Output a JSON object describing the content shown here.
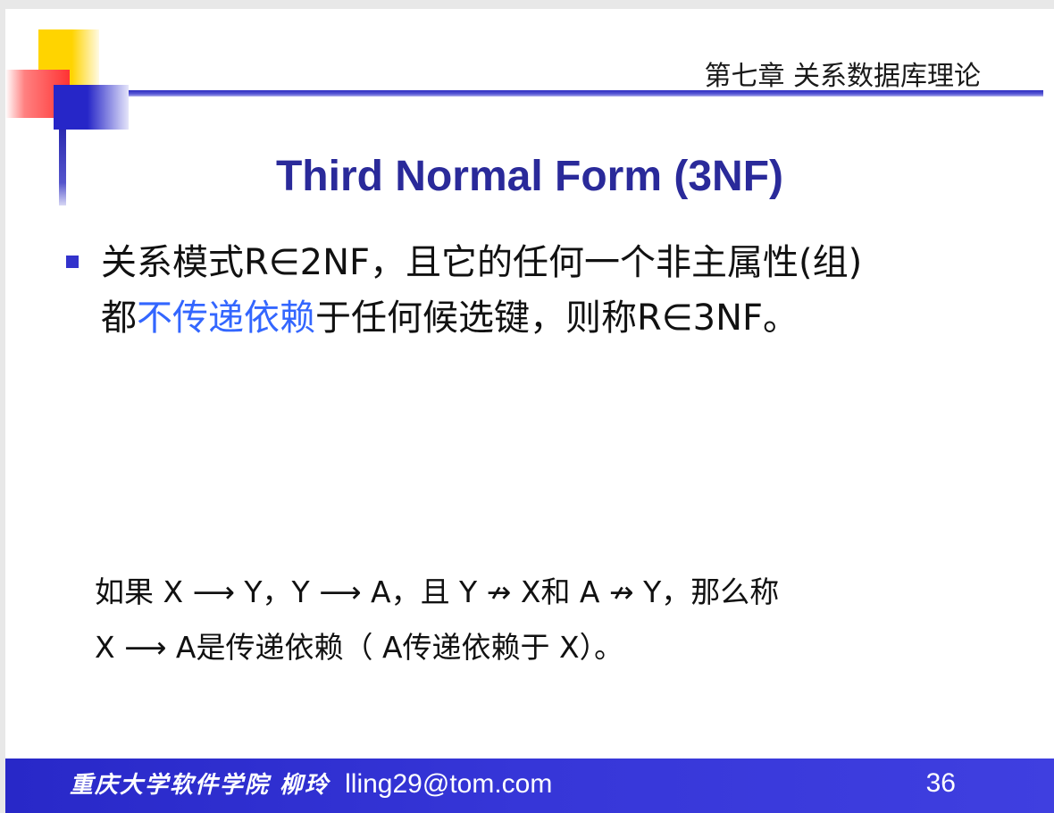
{
  "header": {
    "chapter_title": "第七章 关系数据库理论"
  },
  "slide": {
    "title": "Third Normal Form (3NF)",
    "bullet": {
      "part1": "关系模式R∈2NF，且它的任何一个非主属性(组)",
      "part2_prefix": "都",
      "highlight": "不传递依赖",
      "part2_suffix": "于任何候选键，则称R∈3NF。"
    },
    "definition": {
      "line1": "如果 X ⟶ Y，Y ⟶ A，且 Y ↛ X和 A ↛ Y，那么称",
      "line2": "X ⟶ A是传递依赖（ A传递依赖于 X）。"
    }
  },
  "footer": {
    "school_author": "重庆大学软件学院  柳玲",
    "email": "lling29@tom.com",
    "page_number": "36"
  },
  "colors": {
    "title": "#2a2a9a",
    "highlight": "#3366ff",
    "footer_bg": "#3333d0",
    "bullet": "#3333cc"
  }
}
